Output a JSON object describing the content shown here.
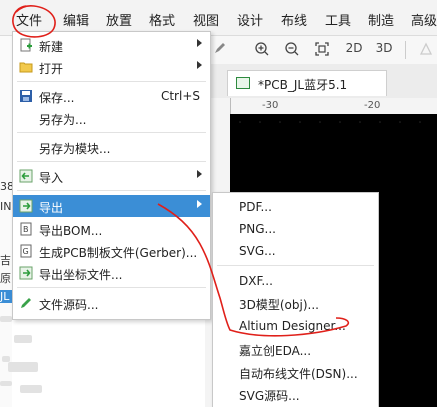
{
  "menubar": {
    "items": [
      "文件",
      "编辑",
      "放置",
      "格式",
      "视图",
      "设计",
      "布线",
      "工具",
      "制造",
      "高级"
    ]
  },
  "toolbar": {
    "zoom_in_icon": "zoom-in-icon",
    "zoom_out_icon": "zoom-out-icon",
    "fit_icon": "fit-view-icon",
    "view_2d": "2D",
    "view_3d": "3D"
  },
  "tab": {
    "label": "*PCB_JL蓝牙5.1"
  },
  "ruler": {
    "ticks": [
      "-30",
      "-20"
    ]
  },
  "left_panel": {
    "texts": [
      "38",
      "IN",
      "JL",
      "吉",
      "原"
    ]
  },
  "file_menu": {
    "items": [
      {
        "label": "新建",
        "shortcut": "",
        "submenu": true,
        "icon": "new-file-icon"
      },
      {
        "label": "打开",
        "shortcut": "",
        "submenu": true,
        "icon": "open-folder-icon"
      },
      {
        "label": "保存...",
        "shortcut": "Ctrl+S",
        "submenu": false,
        "icon": "save-icon"
      },
      {
        "label": "另存为...",
        "shortcut": "",
        "submenu": false,
        "icon": ""
      },
      {
        "label": "另存为模块...",
        "shortcut": "",
        "submenu": false,
        "icon": ""
      },
      {
        "label": "导入",
        "shortcut": "",
        "submenu": true,
        "icon": "import-icon"
      },
      {
        "label": "导出",
        "shortcut": "",
        "submenu": true,
        "icon": "export-icon"
      },
      {
        "label": "导出BOM...",
        "shortcut": "",
        "submenu": false,
        "icon": "bom-icon"
      },
      {
        "label": "生成PCB制板文件(Gerber)...",
        "shortcut": "",
        "submenu": false,
        "icon": "gerber-icon"
      },
      {
        "label": "导出坐标文件...",
        "shortcut": "",
        "submenu": false,
        "icon": "coordinate-icon"
      },
      {
        "label": "文件源码...",
        "shortcut": "",
        "submenu": false,
        "icon": "pencil-icon"
      }
    ]
  },
  "export_menu": {
    "items": [
      "PDF...",
      "PNG...",
      "SVG...",
      "DXF...",
      "3D模型(obj)...",
      "Altium Designer...",
      "嘉立创EDA...",
      "自动布线文件(DSN)...",
      "SVG源码..."
    ]
  },
  "colors": {
    "highlight": "#3b8ed6",
    "annotation": "#e0201a",
    "canvas": "#000000"
  }
}
